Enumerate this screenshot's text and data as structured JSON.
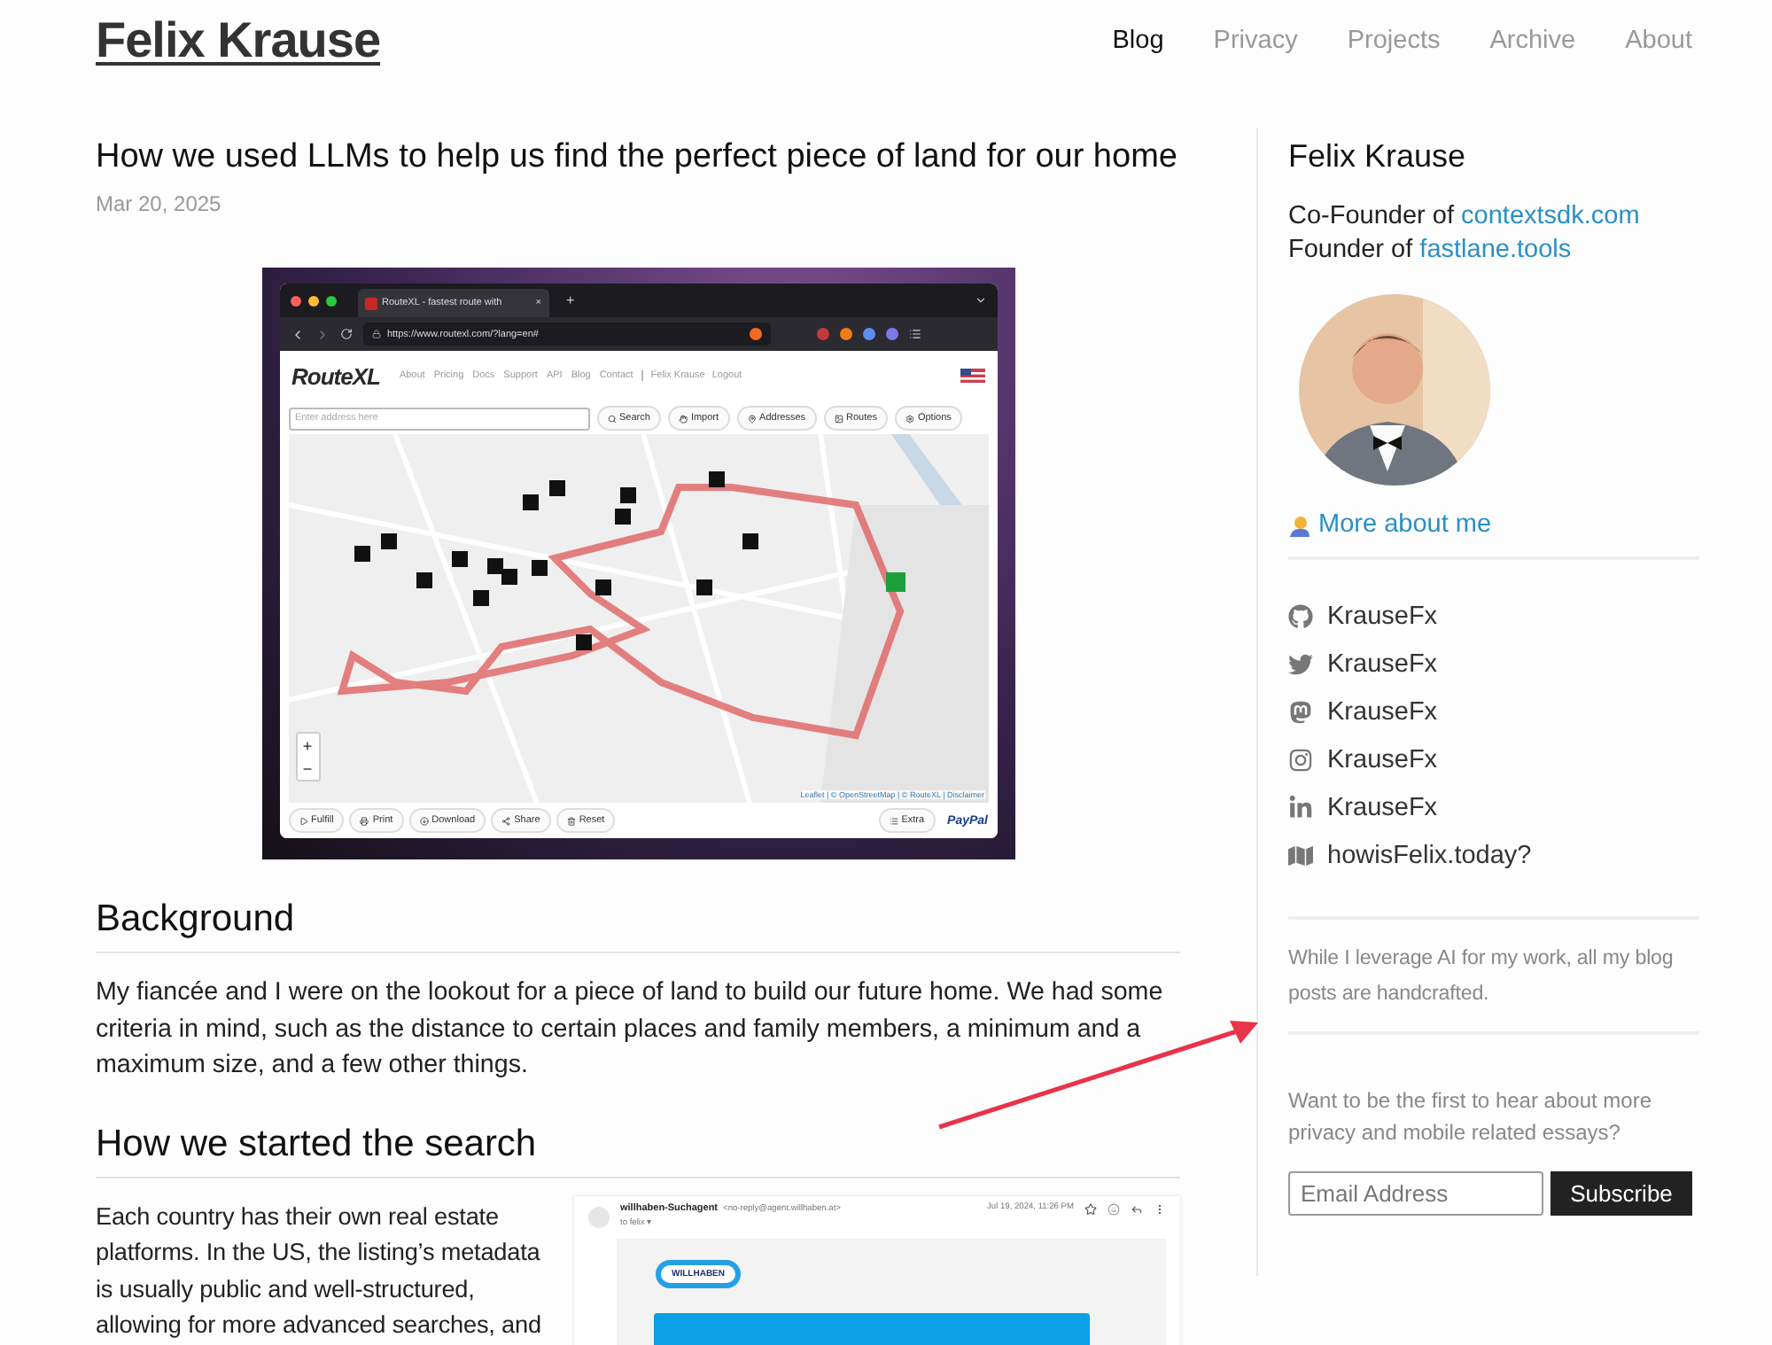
{
  "site_title": "Felix Krause",
  "nav": [
    {
      "label": "Blog",
      "selected": true
    },
    {
      "label": "Privacy",
      "selected": false
    },
    {
      "label": "Projects",
      "selected": false
    },
    {
      "label": "Archive",
      "selected": false
    },
    {
      "label": "About",
      "selected": false
    }
  ],
  "post": {
    "title": "How we used LLMs to help us find the perfect piece of land for our home",
    "date": "Mar 20, 2025",
    "figure": {
      "tab_title": "RouteXL - fastest route with",
      "tab_close": "×",
      "new_tab": "+",
      "url": "https://www.routexl.com/?lang=en#",
      "logo": "RouteXL",
      "site_links": [
        "About",
        "Pricing",
        "Docs",
        "Support",
        "API",
        "Blog",
        "Contact"
      ],
      "account_links": [
        "Felix Krause",
        "Logout"
      ],
      "address_placeholder": "Enter address here",
      "toolbar_buttons": [
        "Search",
        "Import",
        "Addresses",
        "Routes",
        "Options"
      ],
      "zoom_buttons": [
        "+",
        "−"
      ],
      "attribution": "Leaflet | © OpenStreetMap | © RouteXL | Disclaimer",
      "action_buttons": [
        "Fulfill",
        "Print",
        "Download",
        "Share",
        "Reset"
      ],
      "extra_button": "Extra",
      "paypal": "PayPal"
    },
    "sections": [
      {
        "heading": "Background",
        "paragraph": "My fiancée and I were on the lookout for a piece of land to build our future home. We had some criteria in mind, such as the distance to certain places and family members, a minimum and a maximum size, and a few other things."
      },
      {
        "heading": "How we started the search",
        "paragraph": "Each country has their own real estate platforms. In the US, the listing’s metadata is usually public and well-structured, allowing for more advanced searches, and",
        "email": {
          "sender": "willhaben-Suchagent",
          "address": "<no-reply@agent.willhaben.at>",
          "recipient": "to felix ▾",
          "date": "Jul 19, 2024, 11:26 PM",
          "logo": "WILLHABEN"
        }
      }
    ]
  },
  "sidebar": {
    "name": "Felix Krause",
    "roles": [
      {
        "prefix": "Co-Founder of",
        "link": "contextsdk.com"
      },
      {
        "prefix": "Founder of",
        "link": "fastlane.tools"
      }
    ],
    "more_link": "More about me",
    "socials": [
      "KrauseFx",
      "KrauseFx",
      "KrauseFx",
      "KrauseFx",
      "KrauseFx",
      "howisFelix.today?"
    ],
    "note": "While I leverage AI for my work, all my blog posts are handcrafted.",
    "subscribe_text": "Want to be the first to hear about more privacy and mobile related essays?",
    "email_placeholder": "Email Address",
    "subscribe_button": "Subscribe"
  }
}
